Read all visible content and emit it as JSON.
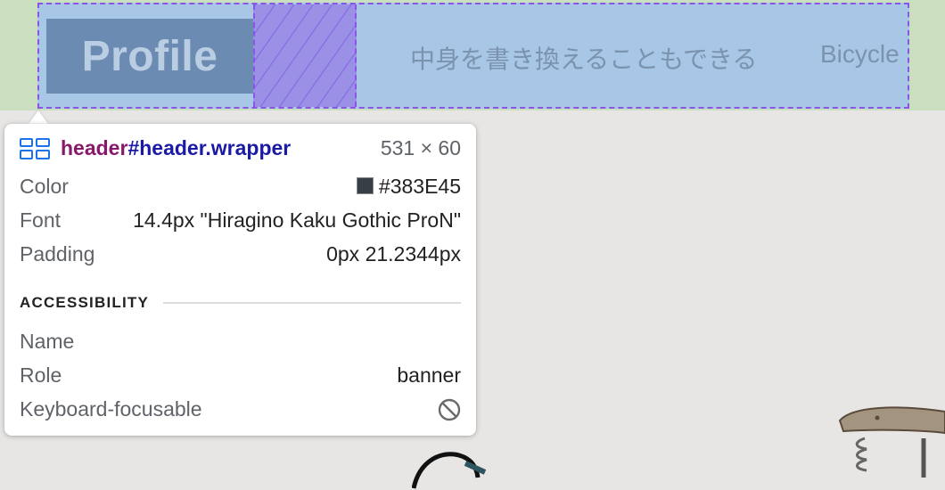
{
  "page": {
    "header": {
      "logo_text": "Profile",
      "nav_items": [
        {
          "label": "中身を書き換えることもできる"
        },
        {
          "label": "Bicycle"
        }
      ]
    }
  },
  "inspector_tooltip": {
    "element_icon": "grid-layout-icon",
    "selector_tag": "header",
    "selector_id_class": "#header.wrapper",
    "dimensions": "531 × 60",
    "properties": {
      "color_label": "Color",
      "color_value": "#383E45",
      "color_swatch": "#383E45",
      "font_label": "Font",
      "font_value": "14.4px \"Hiragino Kaku Gothic ProN\"",
      "padding_label": "Padding",
      "padding_value": "0px 21.2344px"
    },
    "accessibility": {
      "section_title": "ACCESSIBILITY",
      "name_label": "Name",
      "name_value": "",
      "role_label": "Role",
      "role_value": "banner",
      "keyboard_label": "Keyboard-focusable",
      "keyboard_icon": "not-allowed-icon"
    }
  },
  "colors": {
    "header_highlight": "#a8c6e6",
    "margin_highlight": "#c9dfc0",
    "padding_hatch": "#9a90e6",
    "dashed_outline": "#8a55e6",
    "tag_color": "#88186a",
    "id_color": "#1a1aa6"
  }
}
